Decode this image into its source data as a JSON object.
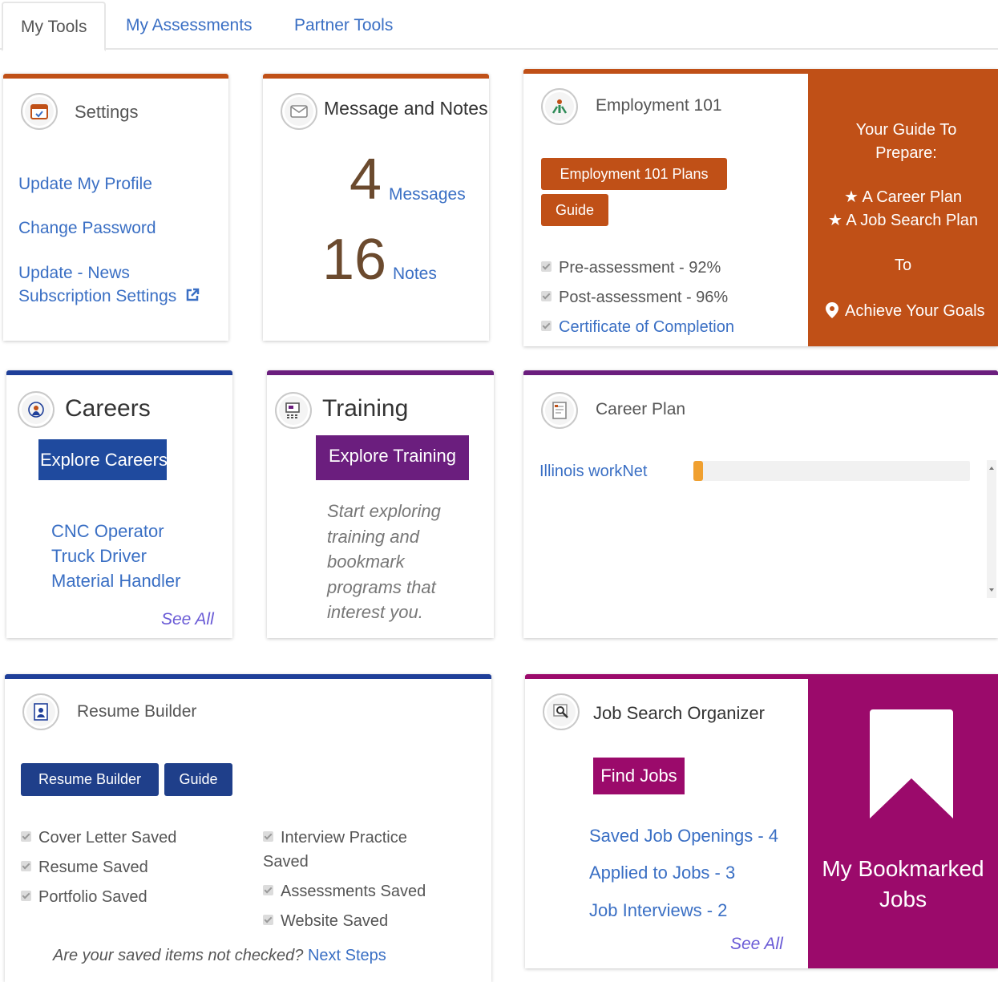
{
  "tabs": [
    "My Tools",
    "My Assessments",
    "Partner Tools"
  ],
  "settings": {
    "title": "Settings",
    "links": [
      "Update My Profile",
      "Change Password",
      "Update - News",
      "Subscription Settings"
    ]
  },
  "messages": {
    "title": "Message and Notes",
    "message_count": "4",
    "message_label": "Messages",
    "note_count": "16",
    "note_label": "Notes"
  },
  "employment": {
    "title": "Employment 101",
    "plans_button": "Employment 101 Plans",
    "guide_button": "Guide",
    "checks": [
      "Pre-assessment - 92%",
      "Post-assessment - 96%"
    ],
    "certificate_link": "Certificate of Completion",
    "promo": {
      "heading": "Your Guide To Prepare:",
      "item1": "A Career Plan",
      "item2": "A Job Search Plan",
      "to": "To",
      "goal": "Achieve Your Goals"
    }
  },
  "careers": {
    "title": "Careers",
    "button": "Explore Careers",
    "links": [
      "CNC Operator",
      "Truck Driver",
      "Material Handler"
    ],
    "see_all": "See All"
  },
  "training": {
    "title": "Training",
    "button": "Explore Training",
    "description": "Start exploring training and bookmark programs that interest you."
  },
  "career_plan": {
    "title": "Career Plan",
    "link": "Illinois workNet",
    "progress": 0.02
  },
  "resume": {
    "title": "Resume Builder",
    "builder_button": "Resume Builder",
    "guide_button": "Guide",
    "checks_left": [
      "Cover Letter Saved",
      "Resume Saved",
      "Portfolio Saved"
    ],
    "checks_right": [
      "Interview Practice Saved",
      "Assessments Saved",
      "Website Saved"
    ],
    "footer_question": "Are your saved items not checked?",
    "footer_link": "Next Steps"
  },
  "job_search": {
    "title": "Job Search Organizer",
    "button": "Find Jobs",
    "links": [
      "Saved Job Openings - 4",
      "Applied to Jobs - 3",
      "Job Interviews - 2"
    ],
    "see_all": "See All",
    "promo": "My Bookmarked Jobs"
  },
  "colors": {
    "orange": "#c05017",
    "blue": "#1f3f99",
    "purple": "#6b1e7e",
    "magenta": "#9b0a6b",
    "link": "#3a6fc4"
  }
}
